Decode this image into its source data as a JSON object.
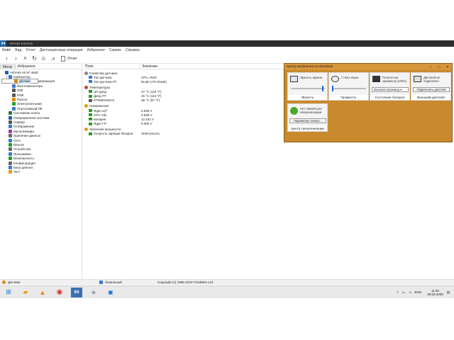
{
  "window": {
    "app_badge": "64",
    "title": "AIDA64 Extreme"
  },
  "menu": [
    "Файл",
    "Вид",
    "Отчет",
    "Дистанционные операции",
    "Избранное",
    "Сервис",
    "Справка"
  ],
  "toolbar": {
    "report_label": "Отчет"
  },
  "left_panel": {
    "tabs": [
      "Меню",
      "Избранное"
    ],
    "active_tab": 0,
    "tree": [
      {
        "label": "AIDA64 v5.97.4600",
        "level": 0,
        "expander": "",
        "color": "#1f5fa8"
      },
      {
        "label": "Компьютер",
        "level": 1,
        "expander": "▾",
        "color": "#3c78c8"
      },
      {
        "label": "Суммарная информация",
        "level": 2,
        "expander": "",
        "color": "#3c78c8"
      },
      {
        "label": "Имя компьютера",
        "level": 2,
        "expander": "",
        "color": "#3c78c8"
      },
      {
        "label": "DMI",
        "level": 2,
        "expander": "",
        "color": "#555555"
      },
      {
        "label": "IPMI",
        "level": 2,
        "expander": "",
        "color": "#555555"
      },
      {
        "label": "Разгон",
        "level": 2,
        "expander": "",
        "color": "#e08a00"
      },
      {
        "label": "Электропитание",
        "level": 2,
        "expander": "",
        "color": "#2a9a2a"
      },
      {
        "label": "Портативный ПК",
        "level": 2,
        "expander": "",
        "color": "#3c78c8"
      },
      {
        "label": "Датчики",
        "level": 2,
        "expander": "",
        "color": "#d48a1a",
        "selected": true
      },
      {
        "label": "Системная плата",
        "level": 1,
        "expander": "›",
        "color": "#2a7a3a"
      },
      {
        "label": "Операционная система",
        "level": 1,
        "expander": "›",
        "color": "#1f5fa8"
      },
      {
        "label": "Сервер",
        "level": 1,
        "expander": "›",
        "color": "#555555"
      },
      {
        "label": "Отображение",
        "level": 1,
        "expander": "›",
        "color": "#3c78c8"
      },
      {
        "label": "Мультимедиа",
        "level": 1,
        "expander": "›",
        "color": "#9a3a9a"
      },
      {
        "label": "Хранение данных",
        "level": 1,
        "expander": "›",
        "color": "#666666"
      },
      {
        "label": "Сеть",
        "level": 1,
        "expander": "›",
        "color": "#2a7ac8"
      },
      {
        "label": "DirectX",
        "level": 1,
        "expander": "›",
        "color": "#2a9a2a"
      },
      {
        "label": "Устройства",
        "level": 1,
        "expander": "›",
        "color": "#666666"
      },
      {
        "label": "Программы",
        "level": 1,
        "expander": "›",
        "color": "#3c78c8"
      },
      {
        "label": "Безопасность",
        "level": 1,
        "expander": "›",
        "color": "#2a9a2a"
      },
      {
        "label": "Конфигурация",
        "level": 1,
        "expander": "›",
        "color": "#666666"
      },
      {
        "label": "База данных",
        "level": 1,
        "expander": "›",
        "color": "#3c78c8"
      },
      {
        "label": "Тест",
        "level": 1,
        "expander": "›",
        "color": "#e0a000"
      }
    ]
  },
  "right_panel": {
    "col_field": "Поле",
    "col_value": "Значение",
    "groups": [
      {
        "title": "Свойства датчика",
        "icon_color": "#888888",
        "rows": [
          {
            "name": "Тип датчика",
            "value": "CPU, HDD",
            "icon_color": "#3c78c8"
          },
          {
            "name": "Тип датчика ГП",
            "value": "Diode  (ATI-Diode)",
            "icon_color": "#3c78c8"
          }
        ]
      },
      {
        "title": "Температуры",
        "icon_color": "#c04040",
        "rows": [
          {
            "name": "ЦП диод",
            "value": "47 °C  (116 °F)",
            "icon_color": "#2a9a2a"
          },
          {
            "name": "Диод ГП",
            "value": "45 °C  (113 °F)",
            "icon_color": "#2a9a2a"
          },
          {
            "name": "ST9500420AS",
            "value": "36 °C  (97 °F)",
            "icon_color": "#555555"
          }
        ]
      },
      {
        "title": "Напряжения",
        "icon_color": "#e0a000",
        "rows": [
          {
            "name": "Ядро ЦП",
            "value": "0.938 V",
            "icon_color": "#2a9a2a"
          },
          {
            "name": "CPU VID",
            "value": "0.938 V",
            "icon_color": "#2a9a2a"
          },
          {
            "name": "Батарея",
            "value": "12.161 V",
            "icon_color": "#2a9a2a"
          },
          {
            "name": "Ядро ГП",
            "value": "0.000 V",
            "icon_color": "#2a9a2a"
          }
        ]
      },
      {
        "title": "Значения мощности",
        "icon_color": "#e0a000",
        "rows": [
          {
            "name": "Скорость зарядки батареи",
            "value": "Электросеть",
            "icon_color": "#2a9a2a"
          }
        ]
      }
    ]
  },
  "mobility_center": {
    "title": "Центр мобильности Windows",
    "tiles": [
      {
        "kind": "brightness",
        "text": "Яркость экрана",
        "label": "Яркость",
        "level": 0.95
      },
      {
        "kind": "volume",
        "text": "Без звука",
        "label": "Громкость",
        "level": 0.0
      },
      {
        "kind": "battery",
        "text": "Полностью заряжена (100%)",
        "select_value": "Высокая производ",
        "label": "Состояние батареи"
      },
      {
        "kind": "display",
        "text": "Дисплей не подключен",
        "button": "Подключить дисплей",
        "label": "Внешний дисплей"
      }
    ],
    "sync": {
      "text": "Нет связей для синхронизации",
      "button": "Параметры синхро...",
      "label": "Центр синхронизации"
    }
  },
  "statusbar": {
    "left": "Датчики",
    "middle": "Локальный",
    "right": "Copyright (c) 1995-2018 FinalWire Ltd."
  },
  "taskbar": {
    "app_badge": "64",
    "tray_lang": "ENG",
    "time": "11:30",
    "date": "28.02.2025"
  }
}
